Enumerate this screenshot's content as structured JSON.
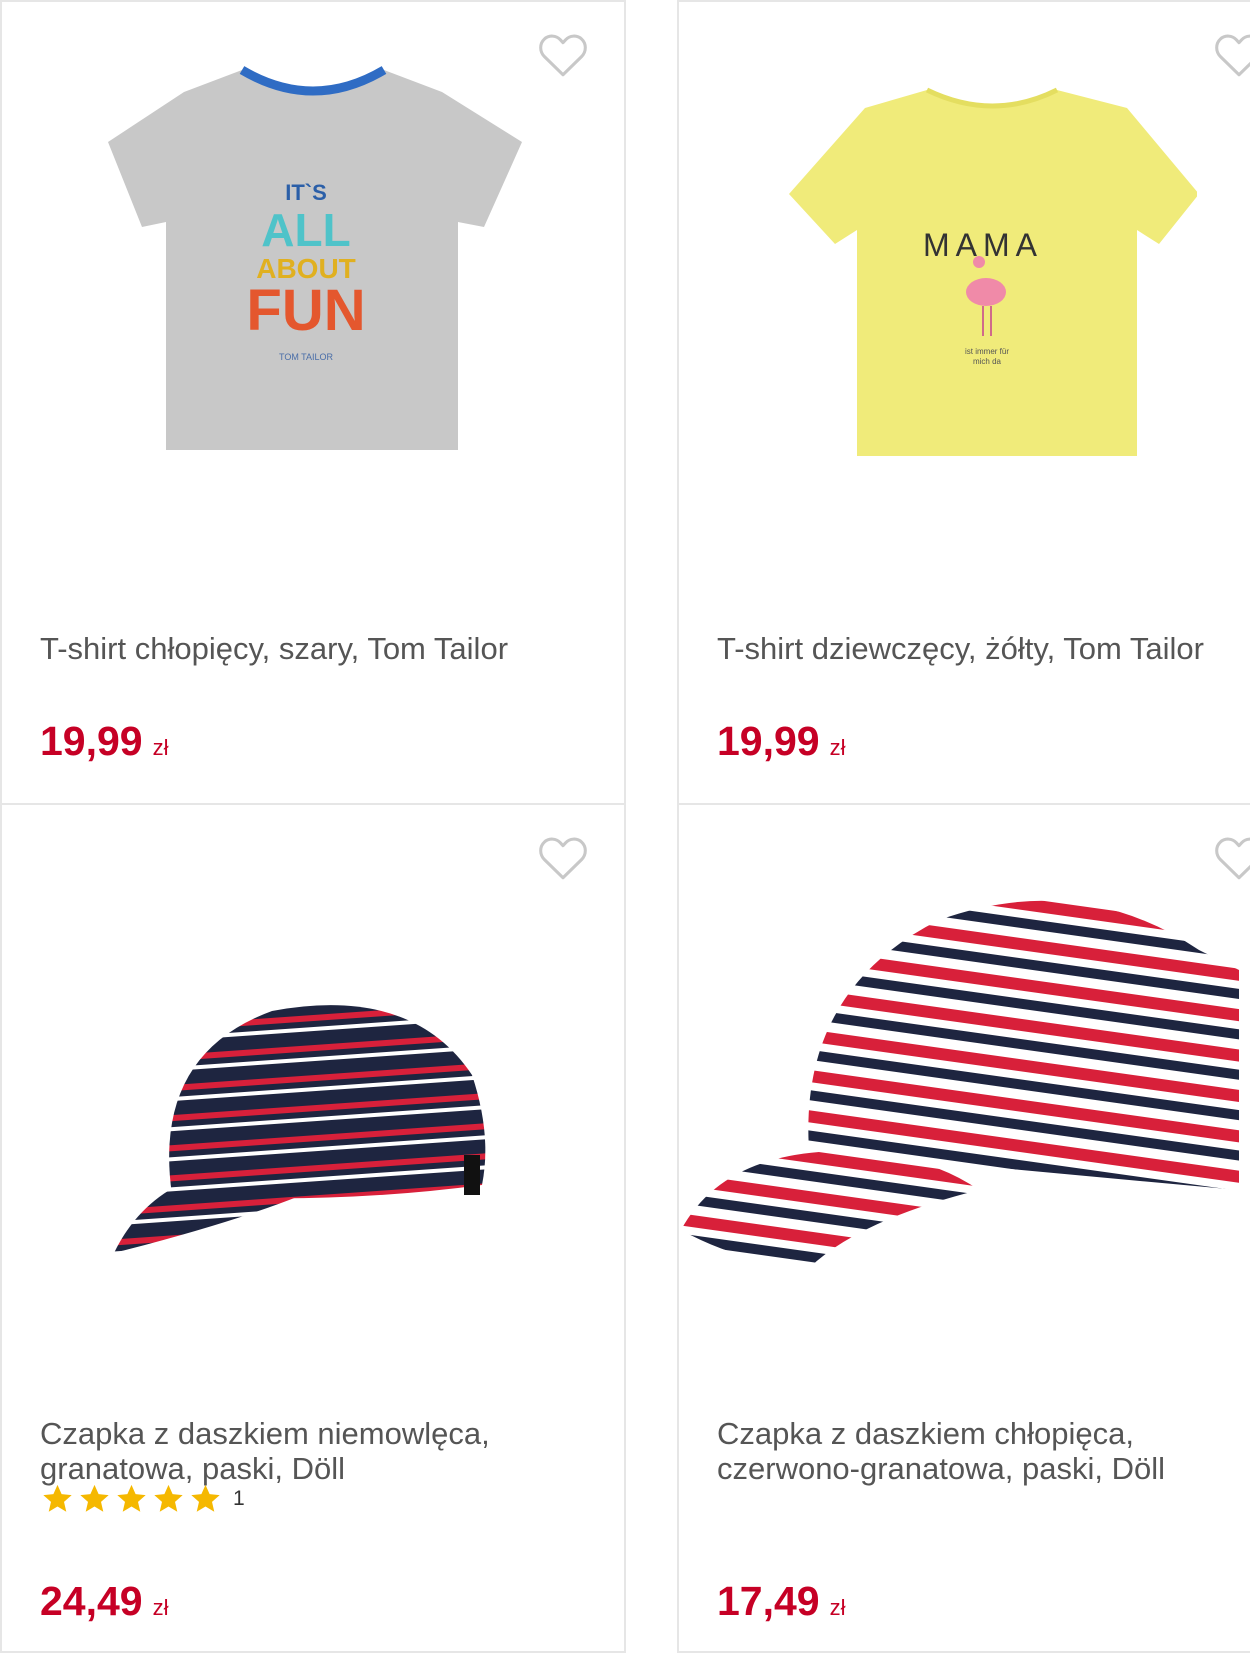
{
  "products": [
    {
      "title": "T-shirt chłopięcy, szary, Tom Tailor",
      "price": "19,99",
      "currency": "zł",
      "print": {
        "l1": "IT`S",
        "l2": "ALL",
        "l3": "ABOUT",
        "l4": "FUN",
        "brand": "TOM TAILOR"
      }
    },
    {
      "title": "T-shirt dziewczęcy, żółty, Tom Tailor",
      "price": "19,99",
      "currency": "zł",
      "print": {
        "l1": "MAMA",
        "l2": "ist immer für",
        "l3": "mich da"
      }
    },
    {
      "title": "Czapka z daszkiem niemowlęca,\ngranatowa, paski, Döll",
      "price": "24,49",
      "currency": "zł",
      "rating": {
        "stars": 5,
        "count": "1"
      }
    },
    {
      "title": "Czapka z daszkiem chłopięca,\nczerwono-granatowa, paski, Döll",
      "price": "17,49",
      "currency": "zł"
    }
  ],
  "colors": {
    "price": "#c60025",
    "star": "#f5b800",
    "heart": "#c8c8c8"
  }
}
